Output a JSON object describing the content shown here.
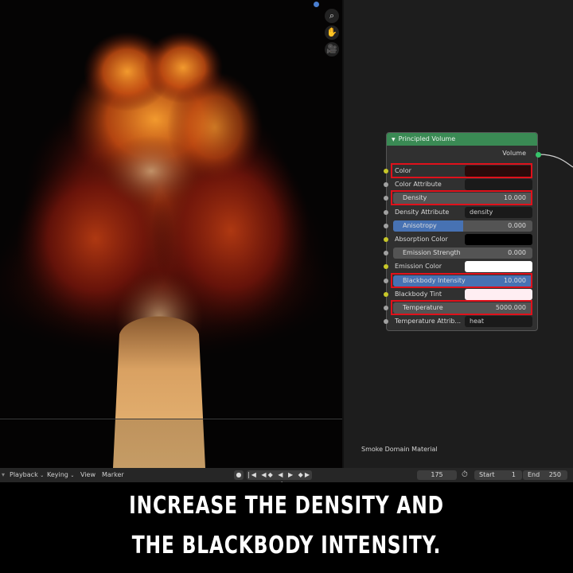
{
  "viewport": {
    "tools": [
      {
        "icon": "magnifier-icon",
        "glyph": "⌕"
      },
      {
        "icon": "hand-icon",
        "glyph": "✋"
      },
      {
        "icon": "camera-icon",
        "glyph": "🎥"
      }
    ]
  },
  "node": {
    "title": "Principled Volume",
    "output_label": "Volume",
    "inputs": [
      {
        "label": "Color",
        "kind": "color",
        "color": "#2a0a0a",
        "socket": "yellow",
        "highlighted": true
      },
      {
        "label": "Color Attribute",
        "kind": "text",
        "value": "",
        "socket": "gray"
      },
      {
        "label": "Density",
        "kind": "slider",
        "value": "10.000",
        "fill": 0,
        "socket": "gray",
        "highlighted": true
      },
      {
        "label": "Density Attribute",
        "kind": "text",
        "value": "density",
        "socket": "gray"
      },
      {
        "label": "Anisotropy",
        "kind": "slider",
        "value": "0.000",
        "fill": 0.5,
        "socket": "gray"
      },
      {
        "label": "Absorption Color",
        "kind": "color",
        "color": "#000000",
        "socket": "yellow"
      },
      {
        "label": "Emission Strength",
        "kind": "slider",
        "value": "0.000",
        "fill": 0,
        "socket": "gray"
      },
      {
        "label": "Emission Color",
        "kind": "color",
        "color": "#ffffff",
        "socket": "yellow"
      },
      {
        "label": "Blackbody Intensity",
        "kind": "slider",
        "value": "10.000",
        "fill": 1,
        "socket": "gray",
        "highlighted": true
      },
      {
        "label": "Blackbody Tint",
        "kind": "color",
        "color": "#ffeef2",
        "socket": "yellow"
      },
      {
        "label": "Temperature",
        "kind": "slider",
        "value": "5000.000",
        "fill": 0,
        "socket": "gray",
        "highlighted": true
      },
      {
        "label": "Temperature Attrib...",
        "kind": "text",
        "value": "heat",
        "socket": "gray"
      }
    ]
  },
  "material_name": "Smoke Domain Material",
  "timeline": {
    "menus": [
      "Playback",
      "Keying",
      "View",
      "Marker"
    ],
    "current_frame": "175",
    "start_label": "Start",
    "start_value": "1",
    "end_label": "End",
    "end_value": "250"
  },
  "caption": {
    "line1": "INCREASE THE DENSITY AND",
    "line2": "THE BLACKBODY INTENSITY."
  },
  "colors": {
    "node_header": "#3a8a54",
    "highlight": "#e0111b",
    "slider_fill": "#4772b3"
  }
}
